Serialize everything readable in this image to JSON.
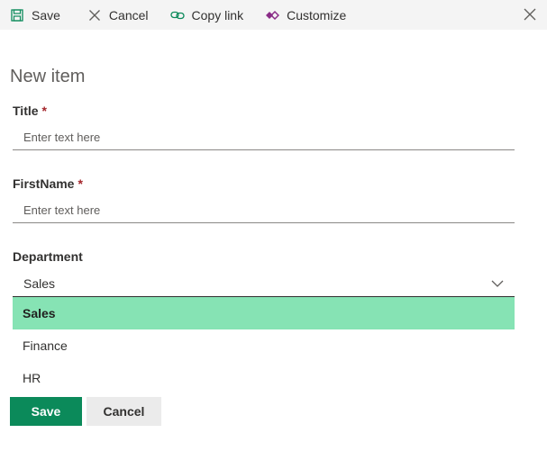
{
  "toolbar": {
    "save": "Save",
    "cancel": "Cancel",
    "copy_link": "Copy link",
    "customize": "Customize"
  },
  "form": {
    "title": "New item",
    "fields": {
      "title": {
        "label": "Title",
        "required_mark": "*",
        "placeholder": "Enter text here",
        "value": ""
      },
      "firstname": {
        "label": "FirstName",
        "required_mark": "*",
        "placeholder": "Enter text here",
        "value": ""
      },
      "department": {
        "label": "Department",
        "selected": "Sales",
        "options": [
          "Sales",
          "Finance",
          "HR"
        ]
      }
    }
  },
  "footer": {
    "save": "Save",
    "cancel": "Cancel"
  },
  "colors": {
    "primary": "#0b8a5a",
    "selected_option": "#86e3b4",
    "required": "#a4262c",
    "toolbar_bg": "#f4f4f4",
    "customize_icon": "#8a2c87",
    "copy_link_icon": "#0b8a5a"
  },
  "icons": {
    "save": "floppy-disk-icon",
    "cancel": "x-icon",
    "copy_link": "link-icon",
    "customize": "power-apps-icon",
    "close": "close-icon",
    "dropdown": "chevron-down-icon"
  }
}
